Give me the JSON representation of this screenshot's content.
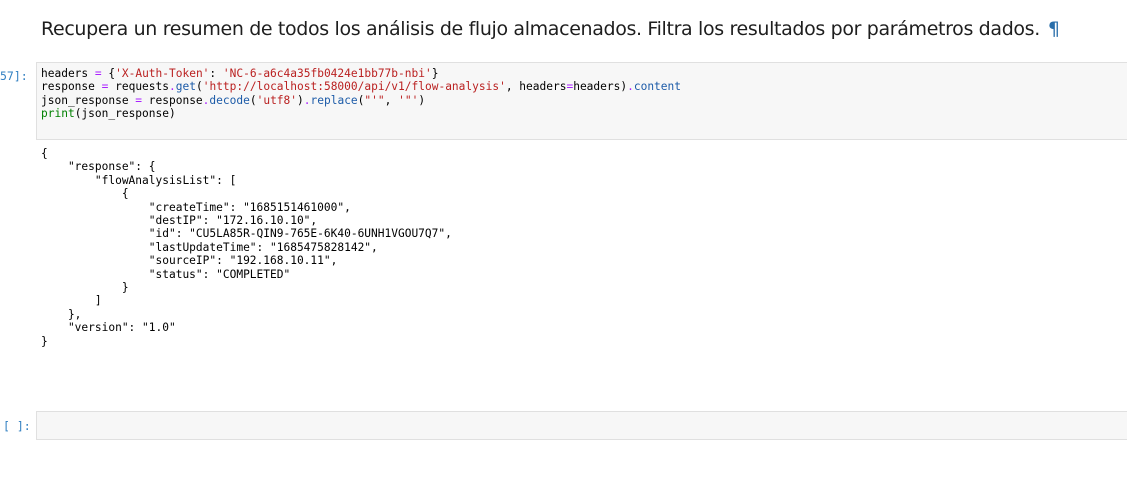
{
  "markdown": {
    "heading": "Recupera un resumen de todos los análisis de flujo almacenados. Filtra los resultados por parámetros dados.",
    "anchor_symbol": "¶"
  },
  "cells": [
    {
      "prompt": "57]:",
      "code_lines": [
        [
          {
            "t": "headers ",
            "c": ""
          },
          {
            "t": "=",
            "c": "o"
          },
          {
            "t": " {",
            "c": ""
          },
          {
            "t": "'X-Auth-Token'",
            "c": "s"
          },
          {
            "t": ": ",
            "c": ""
          },
          {
            "t": "'NC-6-a6c4a35fb0424e1bb77b-nbi'",
            "c": "s"
          },
          {
            "t": "}",
            "c": ""
          }
        ],
        [
          {
            "t": "response ",
            "c": ""
          },
          {
            "t": "=",
            "c": "o"
          },
          {
            "t": " requests",
            "c": ""
          },
          {
            "t": ".",
            "c": "o"
          },
          {
            "t": "get",
            "c": "a"
          },
          {
            "t": "(",
            "c": ""
          },
          {
            "t": "'http://localhost:58000/api/v1/flow-analysis'",
            "c": "s"
          },
          {
            "t": ", headers",
            "c": ""
          },
          {
            "t": "=",
            "c": "o"
          },
          {
            "t": "headers)",
            "c": ""
          },
          {
            "t": ".",
            "c": "o"
          },
          {
            "t": "content",
            "c": "a"
          }
        ],
        [
          {
            "t": "json_response ",
            "c": ""
          },
          {
            "t": "=",
            "c": "o"
          },
          {
            "t": " response",
            "c": ""
          },
          {
            "t": ".",
            "c": "o"
          },
          {
            "t": "decode",
            "c": "a"
          },
          {
            "t": "(",
            "c": ""
          },
          {
            "t": "'utf8'",
            "c": "s"
          },
          {
            "t": ")",
            "c": ""
          },
          {
            "t": ".",
            "c": "o"
          },
          {
            "t": "replace",
            "c": "a"
          },
          {
            "t": "(",
            "c": ""
          },
          {
            "t": "\"'\"",
            "c": "s"
          },
          {
            "t": ", ",
            "c": ""
          },
          {
            "t": "'\"'",
            "c": "s"
          },
          {
            "t": ")",
            "c": ""
          }
        ],
        [
          {
            "t": "print",
            "c": "f"
          },
          {
            "t": "(json_response)",
            "c": ""
          }
        ]
      ],
      "output": "{\n    \"response\": {\n        \"flowAnalysisList\": [\n            {\n                \"createTime\": \"1685151461000\",\n                \"destIP\": \"172.16.10.10\",\n                \"id\": \"CU5LA85R-QIN9-765E-6K40-6UNH1VGOU7Q7\",\n                \"lastUpdateTime\": \"1685475828142\",\n                \"sourceIP\": \"192.168.10.11\",\n                \"status\": \"COMPLETED\"\n            }\n        ]\n    },\n    \"version\": \"1.0\"\n}"
    },
    {
      "prompt": "[ ]:",
      "code_lines": [],
      "output": ""
    }
  ]
}
